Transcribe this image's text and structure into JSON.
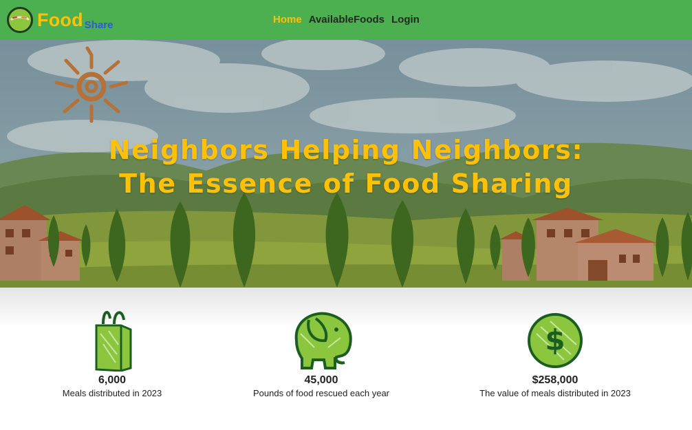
{
  "brand": {
    "name_main": "Food",
    "name_sub": "Share"
  },
  "nav": {
    "items": [
      {
        "label": "Home",
        "active": true
      },
      {
        "label": "AvailableFoods",
        "active": false
      },
      {
        "label": "Login",
        "active": false
      }
    ]
  },
  "hero": {
    "title_line1": "Neighbors Helping Neighbors:",
    "title_line2": "The Essence of Food Sharing"
  },
  "stats": [
    {
      "icon": "shopping-bag-icon",
      "value": "6,000",
      "label": "Meals distributed in 2023"
    },
    {
      "icon": "elephant-icon",
      "value": "45,000",
      "label": "Pounds of food rescued each year"
    },
    {
      "icon": "dollar-coin-icon",
      "value": "$258,000",
      "label": "The value of meals distributed in 2023"
    }
  ],
  "colors": {
    "navbar": "#4caf50",
    "accent_yellow": "#ffc107",
    "brand_blue": "#2e5bd0",
    "icon_green": "#8cc63f",
    "icon_dark": "#1b5e20"
  }
}
